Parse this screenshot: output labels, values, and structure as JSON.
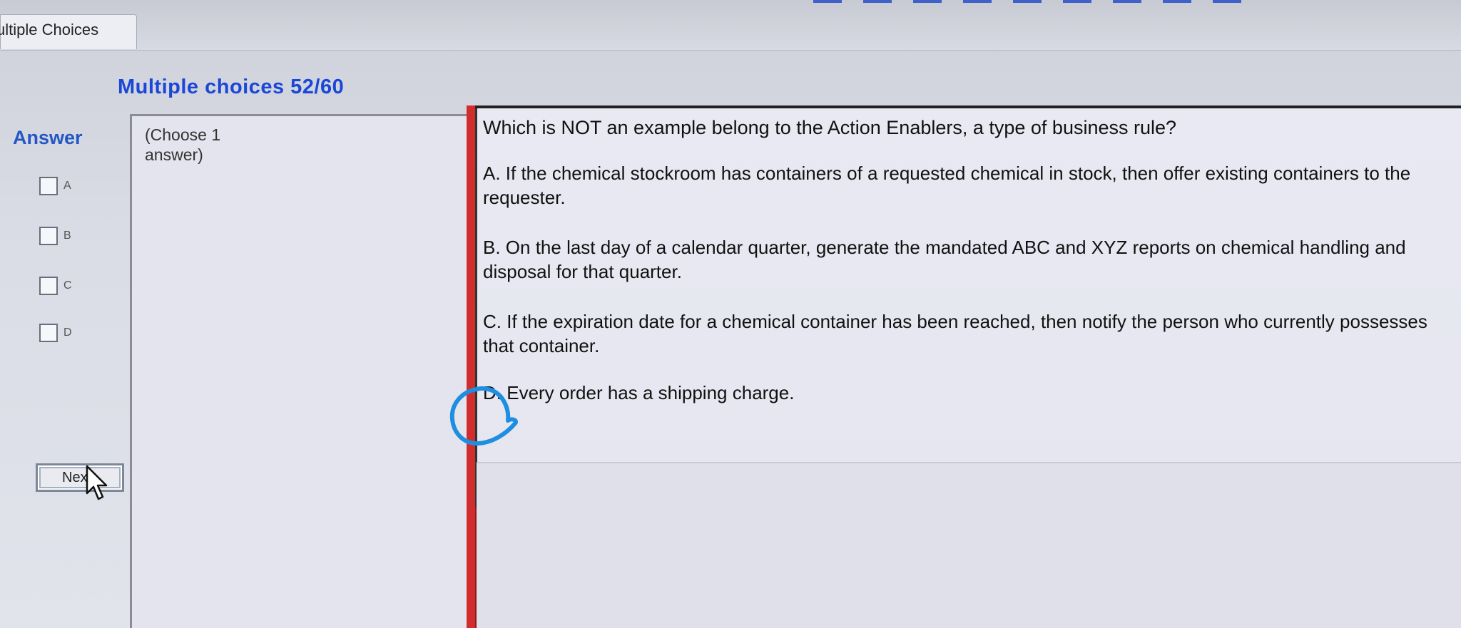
{
  "window": {
    "tab_label": "ultiple Choices"
  },
  "section": {
    "heading": "Multiple choices 52/60"
  },
  "answers": {
    "heading": "Answer",
    "options": [
      {
        "letter": "A",
        "checked": false
      },
      {
        "letter": "B",
        "checked": false
      },
      {
        "letter": "C",
        "checked": false
      },
      {
        "letter": "D",
        "checked": false
      }
    ]
  },
  "instruction": {
    "text": "(Choose 1 answer)"
  },
  "question": {
    "text": "Which is NOT an example belong to the Action Enablers, a type of business rule?",
    "choices": [
      {
        "label": "A",
        "text": "A.  If the chemical stockroom has containers of a requested chemical in stock, then offer existing containers to the requester."
      },
      {
        "label": "B",
        "text": "B.  On the last day of a calendar quarter, generate the mandated ABC and XYZ reports on chemical handling and disposal for that quarter."
      },
      {
        "label": "C",
        "text": "C.  If the expiration date for a chemical container has been reached, then notify the person who currently possesses that container."
      },
      {
        "label": "D",
        "text": "D.  Every order has a shipping charge."
      }
    ]
  },
  "navigation": {
    "next_label": "Next"
  },
  "colors": {
    "heading_blue": "#1a47d6",
    "answer_blue": "#2457c6",
    "red_bar": "#d22d2d",
    "annotation_blue": "#1e8fe0"
  }
}
